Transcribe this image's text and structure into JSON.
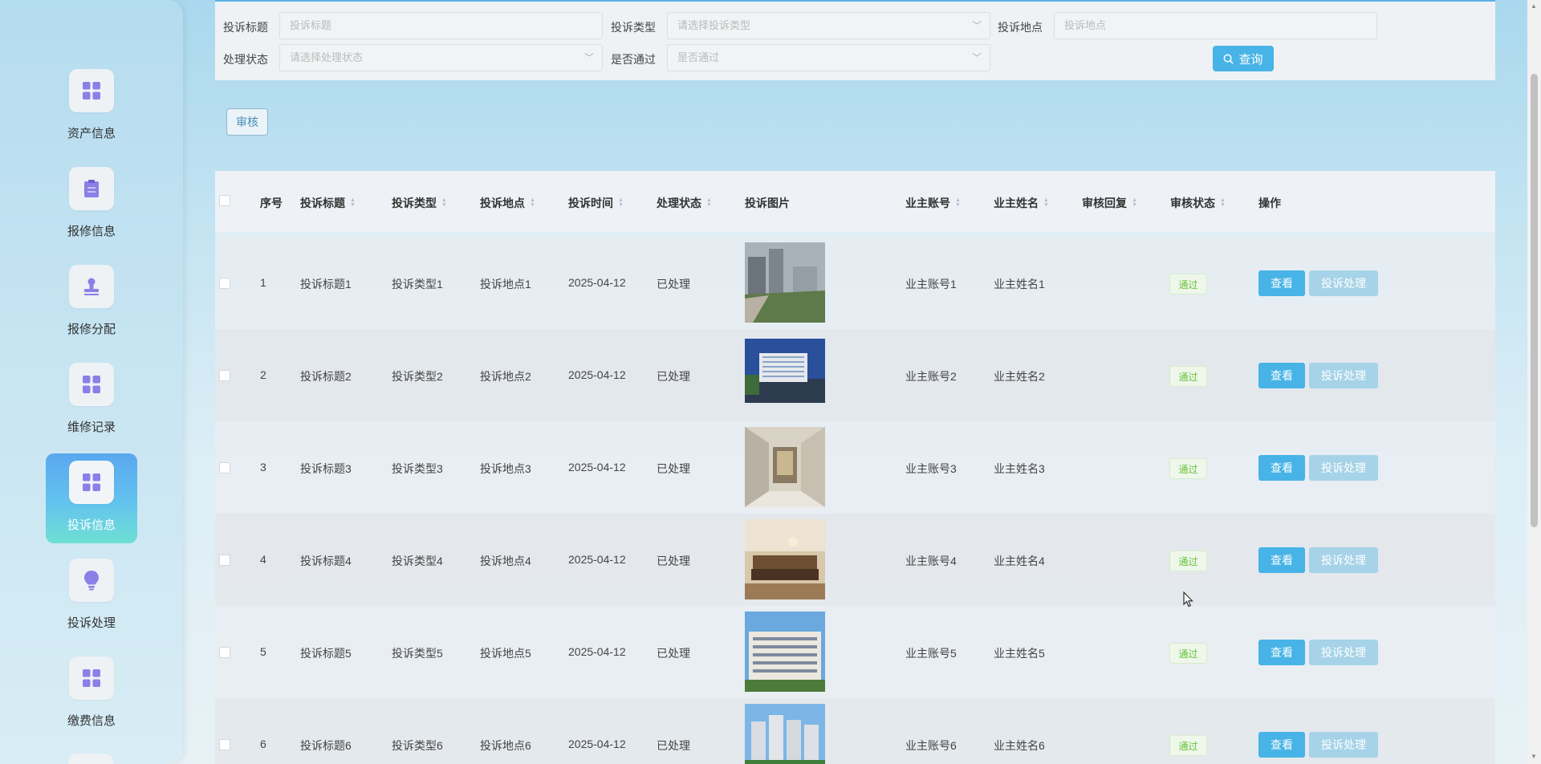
{
  "sidebar": {
    "items": [
      {
        "label": "资产信息",
        "icon": "grid-icon"
      },
      {
        "label": "报修信息",
        "icon": "clipboard-icon"
      },
      {
        "label": "报修分配",
        "icon": "stamp-icon"
      },
      {
        "label": "维修记录",
        "icon": "grid-icon"
      },
      {
        "label": "投诉信息",
        "icon": "grid-icon",
        "active": true
      },
      {
        "label": "投诉处理",
        "icon": "bulb-icon"
      },
      {
        "label": "缴费信息",
        "icon": "grid-icon"
      }
    ]
  },
  "search": {
    "title_label": "投诉标题",
    "title_placeholder": "投诉标题",
    "type_label": "投诉类型",
    "type_placeholder": "请选择投诉类型",
    "place_label": "投诉地点",
    "place_placeholder": "投诉地点",
    "status_label": "处理状态",
    "status_placeholder": "请选择处理状态",
    "pass_label": "是否通过",
    "pass_placeholder": "是否通过",
    "query_label": "查询"
  },
  "toolbar": {
    "audit_label": "审核"
  },
  "table": {
    "headers": {
      "index": "序号",
      "title": "投诉标题",
      "type": "投诉类型",
      "place": "投诉地点",
      "time": "投诉时间",
      "status": "处理状态",
      "image": "投诉图片",
      "account": "业主账号",
      "name": "业主姓名",
      "reply": "审核回复",
      "audit": "审核状态",
      "ops": "操作"
    },
    "rows": [
      {
        "index": "1",
        "title": "投诉标题1",
        "type": "投诉类型1",
        "place": "投诉地点1",
        "time": "2025-04-12",
        "status": "已处理",
        "account": "业主账号1",
        "name": "业主姓名1",
        "audit": "通过"
      },
      {
        "index": "2",
        "title": "投诉标题2",
        "type": "投诉类型2",
        "place": "投诉地点2",
        "time": "2025-04-12",
        "status": "已处理",
        "account": "业主账号2",
        "name": "业主姓名2",
        "audit": "通过"
      },
      {
        "index": "3",
        "title": "投诉标题3",
        "type": "投诉类型3",
        "place": "投诉地点3",
        "time": "2025-04-12",
        "status": "已处理",
        "account": "业主账号3",
        "name": "业主姓名3",
        "audit": "通过"
      },
      {
        "index": "4",
        "title": "投诉标题4",
        "type": "投诉类型4",
        "place": "投诉地点4",
        "time": "2025-04-12",
        "status": "已处理",
        "account": "业主账号4",
        "name": "业主姓名4",
        "audit": "通过"
      },
      {
        "index": "5",
        "title": "投诉标题5",
        "type": "投诉类型5",
        "place": "投诉地点5",
        "time": "2025-04-12",
        "status": "已处理",
        "account": "业主账号5",
        "name": "业主姓名5",
        "audit": "通过"
      },
      {
        "index": "6",
        "title": "投诉标题6",
        "type": "投诉类型6",
        "place": "投诉地点6",
        "time": "2025-04-12",
        "status": "已处理",
        "account": "业主账号6",
        "name": "业主姓名6",
        "audit": "通过"
      }
    ],
    "view_label": "查看",
    "handle_label": "投诉处理"
  },
  "colors": {
    "accent": "#47b3e6",
    "pass_tag": "#67c23a",
    "handle_btn": "#a6d3e8"
  }
}
